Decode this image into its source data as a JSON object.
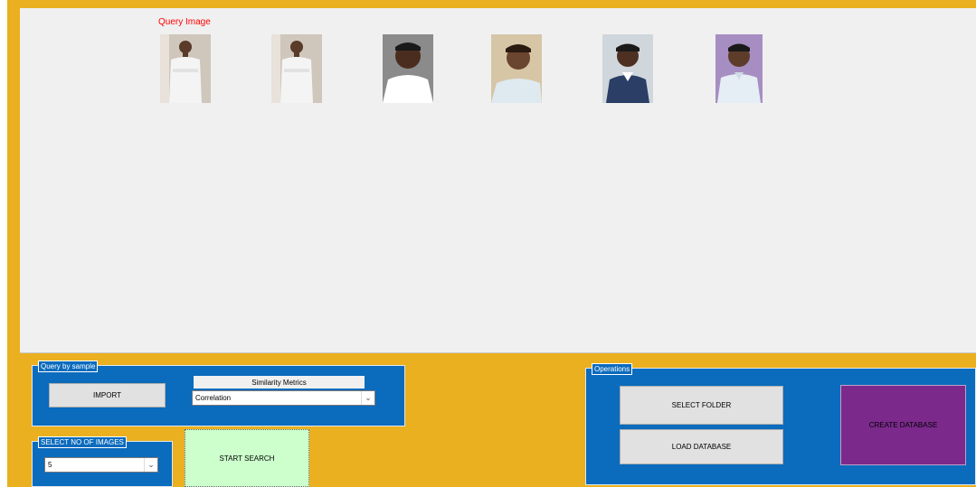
{
  "results": {
    "query_label": "Query Image",
    "images": [
      {
        "alt": "query-photo",
        "bg": "#cfc6bc",
        "shirt": "#f4f4f4",
        "skin": "#5a3a28"
      },
      {
        "alt": "result-photo-1",
        "bg": "#cfc6bc",
        "shirt": "#f4f4f4",
        "skin": "#5a3a28"
      },
      {
        "alt": "result-photo-2",
        "bg": "#8b8b8b",
        "shirt": "#ffffff",
        "skin": "#4a2d1f"
      },
      {
        "alt": "result-photo-3",
        "bg": "#d6c6a6",
        "shirt": "#dfeaf0",
        "skin": "#6a4530"
      },
      {
        "alt": "result-photo-4",
        "bg": "#cfd6dc",
        "shirt": "#2a3e66",
        "skin": "#4e3022"
      },
      {
        "alt": "result-photo-5",
        "bg": "#a78ec2",
        "shirt": "#e6eef5",
        "skin": "#5e3c2a"
      }
    ]
  },
  "query_by_sample": {
    "title": "Query by sample",
    "import_label": "IMPORT",
    "metrics_label": "Similarity Metrics",
    "metric_selected": "Correlation"
  },
  "image_count": {
    "title": "SELECT NO OF IMAGES",
    "selected": "5"
  },
  "start_search_label": "START SEARCH",
  "operations": {
    "title": "Operations",
    "select_folder_label": "SELECT FOLDER",
    "load_database_label": "LOAD DATABASE",
    "create_database_label": "CREATE DATABASE"
  },
  "colors": {
    "frame": "#ebb020",
    "panel": "#0b6bbd",
    "start_search_bg": "#ccffcc",
    "create_database_bg": "#7b2a8c"
  }
}
